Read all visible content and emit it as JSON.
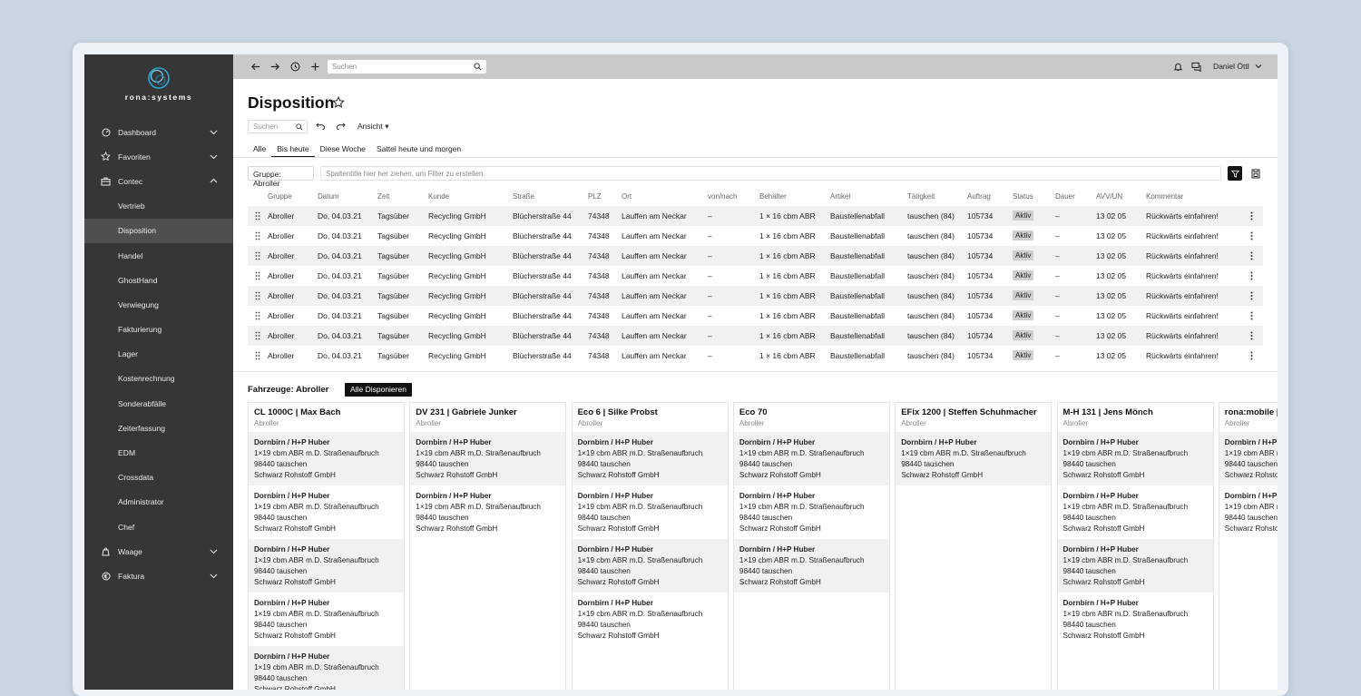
{
  "brand": {
    "name": "rona:systems"
  },
  "sidebar": {
    "items": [
      {
        "label": "Dashboard",
        "level": "top",
        "icon": "dashboard-icon",
        "chevron": "down"
      },
      {
        "label": "Favoriten",
        "level": "top",
        "icon": "star-icon",
        "chevron": "down"
      },
      {
        "label": "Contec",
        "level": "top",
        "icon": "briefcase-icon",
        "chevron": "up"
      },
      {
        "label": "Vertrieb",
        "level": "sub"
      },
      {
        "label": "Disposition",
        "level": "sub",
        "active": true
      },
      {
        "label": "Handel",
        "level": "sub"
      },
      {
        "label": "GhostHand",
        "level": "sub"
      },
      {
        "label": "Verwiegung",
        "level": "sub"
      },
      {
        "label": "Fakturierung",
        "level": "sub"
      },
      {
        "label": "Lager",
        "level": "sub"
      },
      {
        "label": "Kostenrechnung",
        "level": "sub"
      },
      {
        "label": "Sonderabfälle",
        "level": "sub"
      },
      {
        "label": "Zeiterfassung",
        "level": "sub"
      },
      {
        "label": "EDM",
        "level": "sub"
      },
      {
        "label": "Crossdata",
        "level": "sub"
      },
      {
        "label": "Administrator",
        "level": "sub"
      },
      {
        "label": "Chef",
        "level": "sub"
      },
      {
        "label": "Waage",
        "level": "top",
        "icon": "scale-icon",
        "chevron": "down"
      },
      {
        "label": "Faktura",
        "level": "top",
        "icon": "euro-icon",
        "chevron": "down"
      }
    ]
  },
  "topbar": {
    "search_placeholder": "Suchen",
    "user_name": "Daniel Öttl"
  },
  "page": {
    "title": "Disposition",
    "search_placeholder": "Suchen",
    "view_label": "Ansicht ▾",
    "tabs": [
      "Alle",
      "Bis heute",
      "Diese Woche",
      "Sattel heute und morgen"
    ],
    "active_tab": "Bis heute",
    "group_chip": "Gruppe: Abroller",
    "group_drop_hint": "Spaltentitle hier her ziehen, um Filter zu erstellen."
  },
  "table": {
    "columns": [
      "Gruppe",
      "Datum",
      "Zeit",
      "Kunde",
      "Straße",
      "PLZ",
      "Ort",
      "von/nach",
      "Behälter",
      "Artikel",
      "Tätigkeit",
      "Auftrag",
      "Status",
      "Dauer",
      "AVV/UN",
      "Kommentar"
    ],
    "rows": [
      [
        "Abroller",
        "Do, 04.03.21",
        "Tagsüber",
        "Recycling GmbH",
        "Blücherstraße 44",
        "74348",
        "Lauffen am Neckar",
        "–",
        "1 × 16 cbm ABR",
        "Baustellenabfall",
        "tauschen (84)",
        "105734",
        "Aktiv",
        "–",
        "13 02 05",
        "Rückwärts einfahren!"
      ],
      [
        "Abroller",
        "Do, 04.03.21",
        "Tagsüber",
        "Recycling GmbH",
        "Blücherstraße 44",
        "74348",
        "Lauffen am Neckar",
        "–",
        "1 × 16 cbm ABR",
        "Baustellenabfall",
        "tauschen (84)",
        "105734",
        "Aktiv",
        "–",
        "13 02 05",
        "Rückwärts einfahren!"
      ],
      [
        "Abroller",
        "Do, 04.03.21",
        "Tagsüber",
        "Recycling GmbH",
        "Blücherstraße 44",
        "74348",
        "Lauffen am Neckar",
        "–",
        "1 × 16 cbm ABR",
        "Baustellenabfall",
        "tauschen (84)",
        "105734",
        "Aktiv",
        "–",
        "13 02 05",
        "Rückwärts einfahren!"
      ],
      [
        "Abroller",
        "Do, 04.03.21",
        "Tagsüber",
        "Recycling GmbH",
        "Blücherstraße 44",
        "74348",
        "Lauffen am Neckar",
        "–",
        "1 × 16 cbm ABR",
        "Baustellenabfall",
        "tauschen (84)",
        "105734",
        "Aktiv",
        "–",
        "13 02 05",
        "Rückwärts einfahren!"
      ],
      [
        "Abroller",
        "Do, 04.03.21",
        "Tagsüber",
        "Recycling GmbH",
        "Blücherstraße 44",
        "74348",
        "Lauffen am Neckar",
        "–",
        "1 × 16 cbm ABR",
        "Baustellenabfall",
        "tauschen (84)",
        "105734",
        "Aktiv",
        "–",
        "13 02 05",
        "Rückwärts einfahren!"
      ],
      [
        "Abroller",
        "Do, 04.03.21",
        "Tagsüber",
        "Recycling GmbH",
        "Blücherstraße 44",
        "74348",
        "Lauffen am Neckar",
        "–",
        "1 × 16 cbm ABR",
        "Baustellenabfall",
        "tauschen (84)",
        "105734",
        "Aktiv",
        "–",
        "13 02 05",
        "Rückwärts einfahren!"
      ],
      [
        "Abroller",
        "Do, 04.03.21",
        "Tagsüber",
        "Recycling GmbH",
        "Blücherstraße 44",
        "74348",
        "Lauffen am Neckar",
        "–",
        "1 × 16 cbm ABR",
        "Baustellenabfall",
        "tauschen (84)",
        "105734",
        "Aktiv",
        "–",
        "13 02 05",
        "Rückwärts einfahren!"
      ],
      [
        "Abroller",
        "Do, 04.03.21",
        "Tagsüber",
        "Recycling GmbH",
        "Blücherstraße 44",
        "74348",
        "Lauffen am Neckar",
        "–",
        "1 × 16 cbm ABR",
        "Baustellenabfall",
        "tauschen (84)",
        "105734",
        "Aktiv",
        "–",
        "13 02 05",
        "Rückwärts einfahren!"
      ]
    ]
  },
  "vehicles": {
    "title": "Fahrzeuge: Abroller",
    "button_label": "Alle Disponieren",
    "job": {
      "place": "Dornbirn / H+P Huber",
      "material": "1×19 cbm ABR m.D. Straßenaufbruch",
      "action": "98440 tauschen",
      "company": "Schwarz Rohstoff GmbH"
    },
    "cards": [
      {
        "title": "CL 1000C | Max Bach",
        "sub": "Abroller",
        "jobs": 5
      },
      {
        "title": "DV 231 | Gabriele Junker",
        "sub": "Abroller",
        "jobs": 2
      },
      {
        "title": "Eco 6 | Silke Probst",
        "sub": "Abroller",
        "jobs": 4
      },
      {
        "title": "Eco 70",
        "sub": "Abroller",
        "jobs": 3
      },
      {
        "title": "EFix 1200 | Steffen Schuhmacher",
        "sub": "Abroller",
        "jobs": 1
      },
      {
        "title": "M-H 131 | Jens Mönch",
        "sub": "Abroller",
        "jobs": 4
      },
      {
        "title": "rona:mobile | Klaus Teller",
        "sub": "Abroller",
        "jobs": 2
      }
    ]
  },
  "colors": {
    "sidebar": "#363636",
    "topbar": "#c9c9c9",
    "active_nav": "#4f4f4f",
    "row_alt": "#f1f1f1",
    "badge": "#cfcfcf"
  }
}
